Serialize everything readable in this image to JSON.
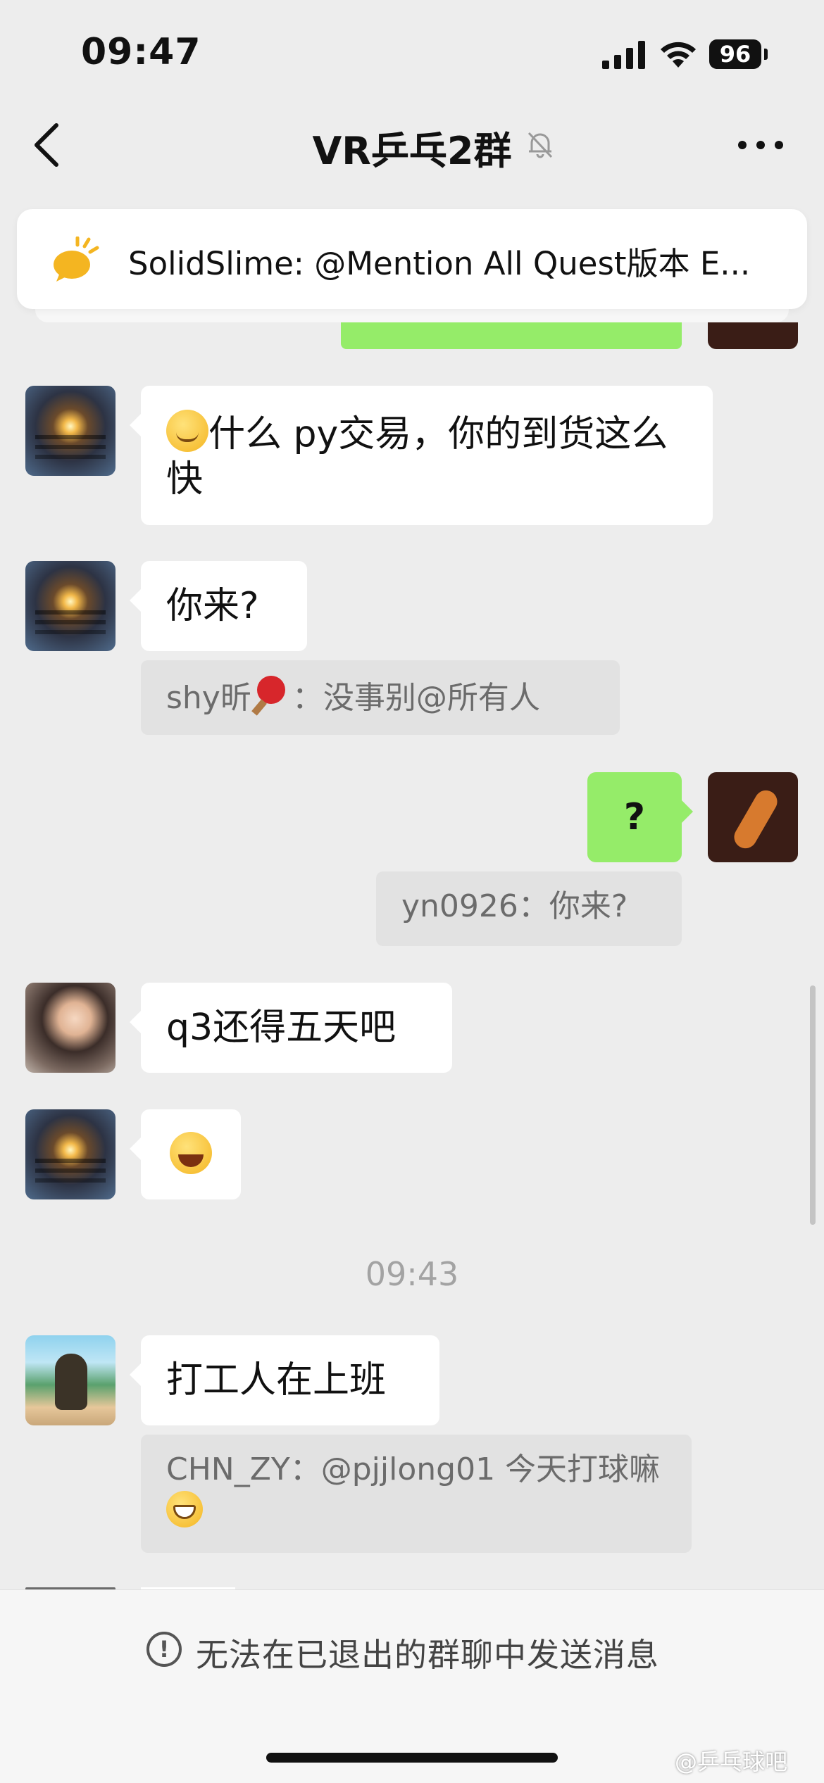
{
  "status_bar": {
    "time": "09:47",
    "battery": "96"
  },
  "nav": {
    "title": "VR乒乓2群"
  },
  "pinned": {
    "text": "SolidSlime: @Mention All Quest版本 E..."
  },
  "messages": {
    "m1_text": "什么 py交易，你的到货这么快",
    "m2_text": "你来?",
    "m2_quote_before": "shy昕",
    "m2_quote_after": "：没事别@所有人",
    "m3_text": "?",
    "m3_quote": "yn0926：你来?",
    "m4_text": "q3还得五天吧",
    "timestamp": "09:43",
    "m6_text": "打工人在上班",
    "m6_quote": "CHN_ZY：@pjjlong01 今天打球嘛"
  },
  "footer": {
    "notice": "无法在已退出的群聊中发送消息"
  },
  "watermark": "@乒乓球吧"
}
